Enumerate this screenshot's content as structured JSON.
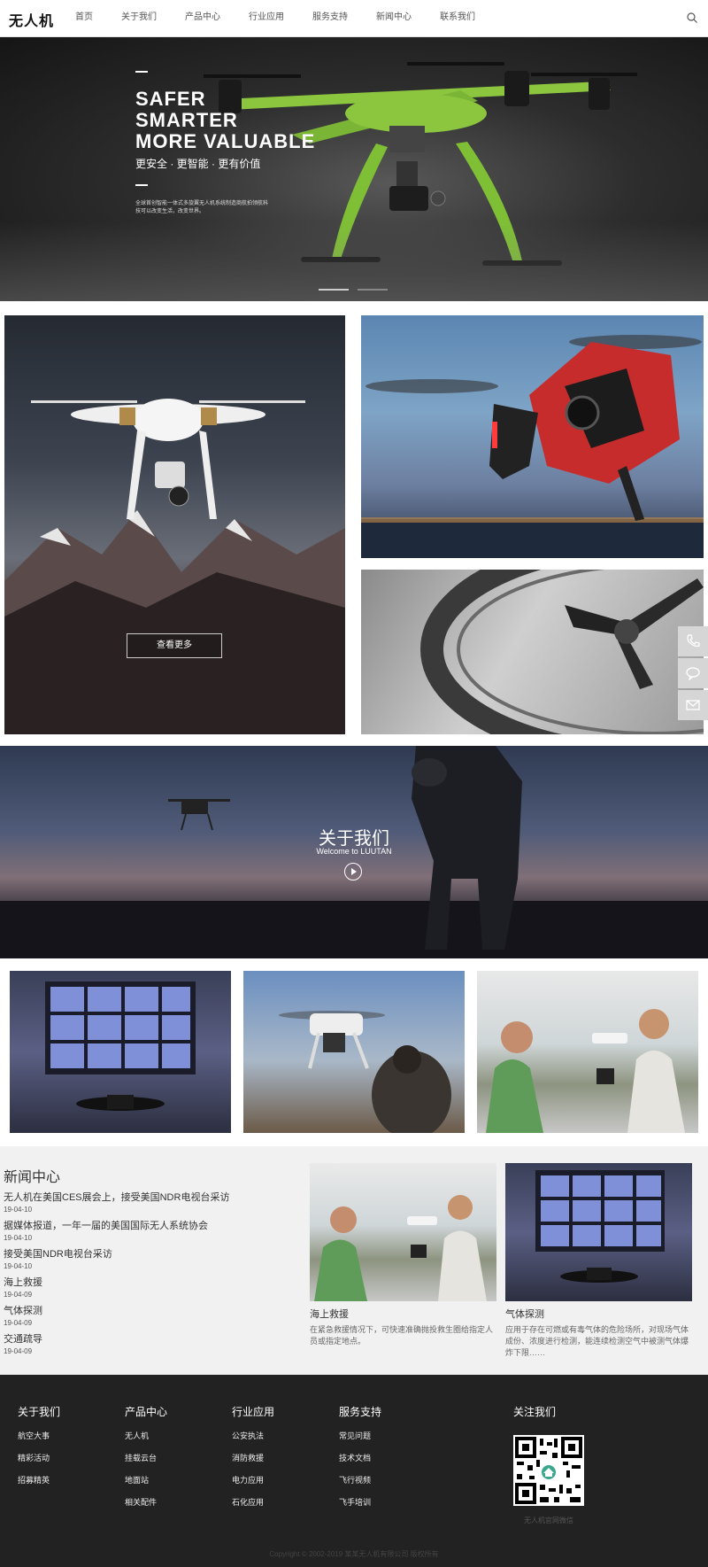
{
  "header": {
    "logo": "无人机",
    "nav": [
      "首页",
      "关于我们",
      "产品中心",
      "行业应用",
      "服务支持",
      "新闻中心",
      "联系我们"
    ]
  },
  "hero": {
    "title": "SAFER\nSMARTER\nMORE  VALUABLE",
    "subtitle": "更安全 · 更智能 · 更有价值",
    "description": "全球首创智能一体式多旋翼无人机系统制造商航拍领航科技可以改变生活，改变世界。",
    "slides": 2,
    "active_slide": 1
  },
  "products": {
    "more_button": "查看更多"
  },
  "side_tools": [
    "phone-icon",
    "chat-icon",
    "mail-icon"
  ],
  "about": {
    "title": "关于我们",
    "subtitle": "Welcome to LUUTAN"
  },
  "news": {
    "heading": "新闻中心",
    "items": [
      {
        "title": "无人机在美国CES展会上，接受美国NDR电视台采访",
        "date": "19-04-10"
      },
      {
        "title": "据媒体报道，一年一届的美国国际无人系统协会",
        "date": "19-04-10"
      },
      {
        "title": "接受美国NDR电视台采访",
        "date": "19-04-10"
      },
      {
        "title": "海上救援",
        "date": "19-04-09"
      },
      {
        "title": "气体探测",
        "date": "19-04-09"
      },
      {
        "title": "交通疏导",
        "date": "19-04-09"
      }
    ],
    "cards": [
      {
        "title": "海上救援",
        "desc": "在紧急救援情况下，可快速准确抛投救生圈给指定人员或指定地点。"
      },
      {
        "title": "气体探测",
        "desc": "应用于存在可燃或有毒气体的危险场所，对现场气体成份、浓度进行检测，能连续检测空气中被测气体爆炸下限……"
      }
    ]
  },
  "footer": {
    "columns": [
      {
        "heading": "关于我们",
        "items": [
          "航空大事",
          "精彩活动",
          "招募精英"
        ]
      },
      {
        "heading": "产品中心",
        "items": [
          "无人机",
          "挂载云台",
          "地面站",
          "相关配件"
        ]
      },
      {
        "heading": "行业应用",
        "items": [
          "公安执法",
          "消防救援",
          "电力应用",
          "石化应用"
        ]
      },
      {
        "heading": "服务支持",
        "items": [
          "常见问题",
          "技术文档",
          "飞行视频",
          "飞手培训"
        ]
      }
    ],
    "follow_heading": "关注我们",
    "qr_caption": "无人机官网微信",
    "copyright": "Copyright © 2002-2019 某某无人机有限公司 版权所有"
  },
  "colors": {
    "drone_green": "#8cc63f",
    "footer_bg": "#222222",
    "news_bg": "#f1f1f1"
  }
}
